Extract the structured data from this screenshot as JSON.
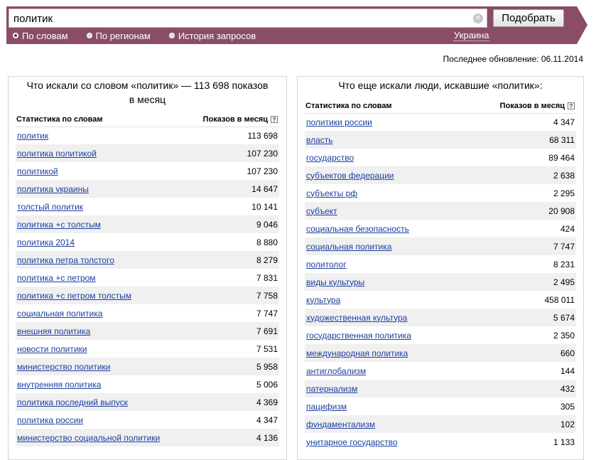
{
  "search": {
    "value": "политик",
    "submit_label": "Подобрать"
  },
  "modes": [
    {
      "label": "По словам",
      "checked": true
    },
    {
      "label": "По регионам",
      "checked": false
    },
    {
      "label": "История запросов",
      "checked": false
    }
  ],
  "region": "Украина",
  "last_update": "Последнее обновление: 06.11.2014",
  "left": {
    "title": "Что искали со словом «политик» — 113 698 показов в месяц",
    "col_word": "Статистика по словам",
    "col_count": "Показов в месяц",
    "rows": [
      {
        "word": "политик",
        "count": "113 698"
      },
      {
        "word": "политика политикой",
        "count": "107 230"
      },
      {
        "word": "политикой",
        "count": "107 230"
      },
      {
        "word": "политика украины",
        "count": "14 647"
      },
      {
        "word": "толстый политик",
        "count": "10 141"
      },
      {
        "word": "политика +с толстым",
        "count": "9 046"
      },
      {
        "word": "политика 2014",
        "count": "8 880"
      },
      {
        "word": "политика петра толстого",
        "count": "8 279"
      },
      {
        "word": "политика +с петром",
        "count": "7 831"
      },
      {
        "word": "политика +с петром толстым",
        "count": "7 758"
      },
      {
        "word": "социальная политика",
        "count": "7 747"
      },
      {
        "word": "внешняя политика",
        "count": "7 691"
      },
      {
        "word": "новости политики",
        "count": "7 531"
      },
      {
        "word": "министерство политики",
        "count": "5 958"
      },
      {
        "word": "внутренняя политика",
        "count": "5 006"
      },
      {
        "word": "политика последний выпуск",
        "count": "4 369"
      },
      {
        "word": "политика россии",
        "count": "4 347"
      },
      {
        "word": "министерство социальной политики",
        "count": "4 136"
      }
    ]
  },
  "right": {
    "title": "Что еще искали люди, искавшие «политик»:",
    "col_word": "Статистика по словам",
    "col_count": "Показов в месяц",
    "rows": [
      {
        "word": "политики россии",
        "count": "4 347"
      },
      {
        "word": "власть",
        "count": "68 311"
      },
      {
        "word": "государство",
        "count": "89 464"
      },
      {
        "word": "субъектов федерации",
        "count": "2 638"
      },
      {
        "word": "субъекты рф",
        "count": "2 295"
      },
      {
        "word": "субъект",
        "count": "20 908"
      },
      {
        "word": "социальная безопасность",
        "count": "424"
      },
      {
        "word": "социальная политика",
        "count": "7 747"
      },
      {
        "word": "политолог",
        "count": "8 231"
      },
      {
        "word": "виды культуры",
        "count": "2 495"
      },
      {
        "word": "культура",
        "count": "458 011"
      },
      {
        "word": "художественная культура",
        "count": "5 674"
      },
      {
        "word": "государственная политика",
        "count": "2 350"
      },
      {
        "word": "международная политика",
        "count": "660"
      },
      {
        "word": "антиглобализм",
        "count": "144"
      },
      {
        "word": "патернализм",
        "count": "432"
      },
      {
        "word": "пацифизм",
        "count": "305"
      },
      {
        "word": "фундаментализм",
        "count": "102"
      },
      {
        "word": "унитарное государство",
        "count": "1 133"
      }
    ]
  }
}
